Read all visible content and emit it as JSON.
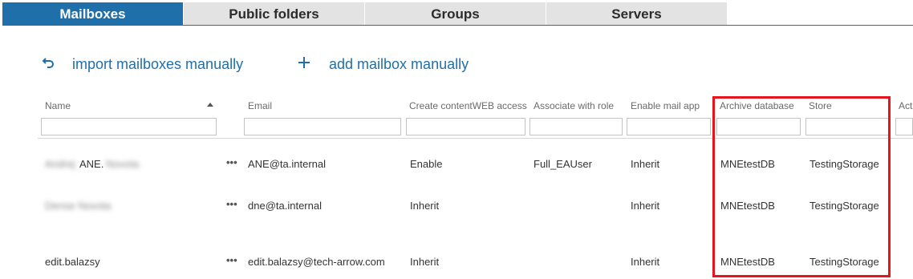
{
  "tabs": [
    {
      "label": "Mailboxes",
      "active": true
    },
    {
      "label": "Public folders",
      "active": false
    },
    {
      "label": "Groups",
      "active": false
    },
    {
      "label": "Servers",
      "active": false
    }
  ],
  "actions": {
    "import_icon": "undo-arrow-icon",
    "import_label": "import mailboxes manually",
    "add_icon": "plus-icon",
    "add_label": "add mailbox manually"
  },
  "columns": {
    "name": "Name",
    "email": "Email",
    "contentweb": "Create contentWEB access",
    "role": "Associate with role",
    "mailapp": "Enable mail app",
    "archive": "Archive database",
    "store": "Store",
    "actions_partial": "Act"
  },
  "rows": [
    {
      "name_blur_first": "Andrej",
      "name_visible": "ANE.",
      "name_blur_last": "Novota",
      "email": "ANE@ta.internal",
      "contentweb": "Enable",
      "role": "Full_EAUser",
      "mailapp": "Inherit",
      "archive": "MNEtestDB",
      "store": "TestingStorage"
    },
    {
      "name_blur_first": "Dense Novota",
      "name_visible": "",
      "name_blur_last": "",
      "email": "dne@ta.internal",
      "contentweb": "Inherit",
      "role": "",
      "mailapp": "Inherit",
      "archive": "MNEtestDB",
      "store": "TestingStorage"
    },
    {
      "name_blur_first": "",
      "name_visible": "edit.balazsy",
      "name_blur_last": "",
      "email": "edit.balazsy@tech-arrow.com",
      "contentweb": "Inherit",
      "role": "",
      "mailapp": "Inherit",
      "archive": "MNEtestDB",
      "store": "TestingStorage"
    }
  ],
  "row_menu": "•••",
  "colors": {
    "accent": "#1f6fab",
    "highlight": "#e8141b",
    "tab_inactive": "#e3e3e3"
  }
}
